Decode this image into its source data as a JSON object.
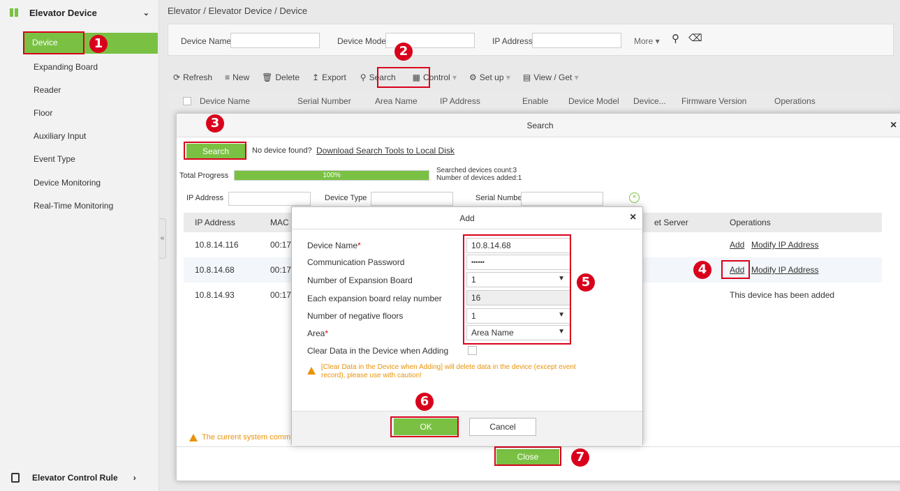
{
  "sidebar": {
    "module_title": "Elevator Device",
    "active_item": "Device",
    "items": [
      "Expanding Board",
      "Reader",
      "Floor",
      "Auxiliary Input",
      "Event Type",
      "Device Monitoring",
      "Real-Time Monitoring"
    ],
    "footer_module": "Elevator Control Rule"
  },
  "breadcrumb": "Elevator / Elevator Device / Device",
  "filter": {
    "device_name_label": "Device Name",
    "device_model_label": "Device Model",
    "ip_address_label": "IP Address",
    "more_label": "More"
  },
  "toolbar": {
    "refresh": "Refresh",
    "new": "New",
    "delete": "Delete",
    "export": "Export",
    "search": "Search",
    "control": "Control",
    "setup": "Set up",
    "view_get": "View / Get"
  },
  "grid_headers": [
    "Device Name",
    "Serial Number",
    "Area Name",
    "IP Address",
    "Enable",
    "Device Model",
    "Device...",
    "Firmware Version",
    "Operations"
  ],
  "search_dialog": {
    "title": "Search",
    "search_button": "Search",
    "no_device_text": "No device found?",
    "download_link": "Download Search Tools to Local Disk",
    "total_progress_label": "Total Progress",
    "progress_text": "100%",
    "progress_value": 1.0,
    "searched_count": "Searched devices count:3",
    "added_count": "Number of devices added:1",
    "ip_filter_label": "IP Address",
    "device_type_label": "Device Type",
    "serial_number_label": "Serial Number",
    "col_ip": "IP Address",
    "col_mac": "MAC",
    "col_server": "et Server",
    "col_operations": "Operations",
    "rows": [
      {
        "ip": "10.8.14.116",
        "mac": "00:17",
        "op_add": "Add",
        "op_modify": "Modify IP Address"
      },
      {
        "ip": "10.8.14.68",
        "mac": "00:17",
        "op_add": "Add",
        "op_modify": "Modify IP Address"
      },
      {
        "ip": "10.8.14.93",
        "mac": "00:17",
        "status": "This device has been added"
      }
    ],
    "bottom_warning": "The current system comm",
    "close_button": "Close"
  },
  "add_dialog": {
    "title": "Add",
    "device_name_label": "Device Name",
    "device_name_value": "10.8.14.68",
    "comm_password_label": "Communication Password",
    "comm_password_value": "••••••",
    "expansion_board_label": "Number of Expansion Board",
    "expansion_board_value": "1",
    "relay_number_label": "Each expansion board relay number",
    "relay_number_value": "16",
    "negative_floors_label": "Number of negative floors",
    "negative_floors_value": "1",
    "area_label": "Area",
    "area_value": "Area Name",
    "clear_data_label": "Clear Data in the Device when Adding",
    "warning_line1": "[Clear Data in the Device when Adding] will delete data in the device (except event",
    "warning_line2": "record), please use with caution!",
    "ok_button": "OK",
    "cancel_button": "Cancel",
    "required_mark": "*"
  },
  "callouts": [
    "1",
    "2",
    "3",
    "4",
    "5",
    "6",
    "7"
  ],
  "colors": {
    "accent_green": "#7ac143",
    "highlight_red": "#d9001b",
    "warning_orange": "#e8930c"
  }
}
